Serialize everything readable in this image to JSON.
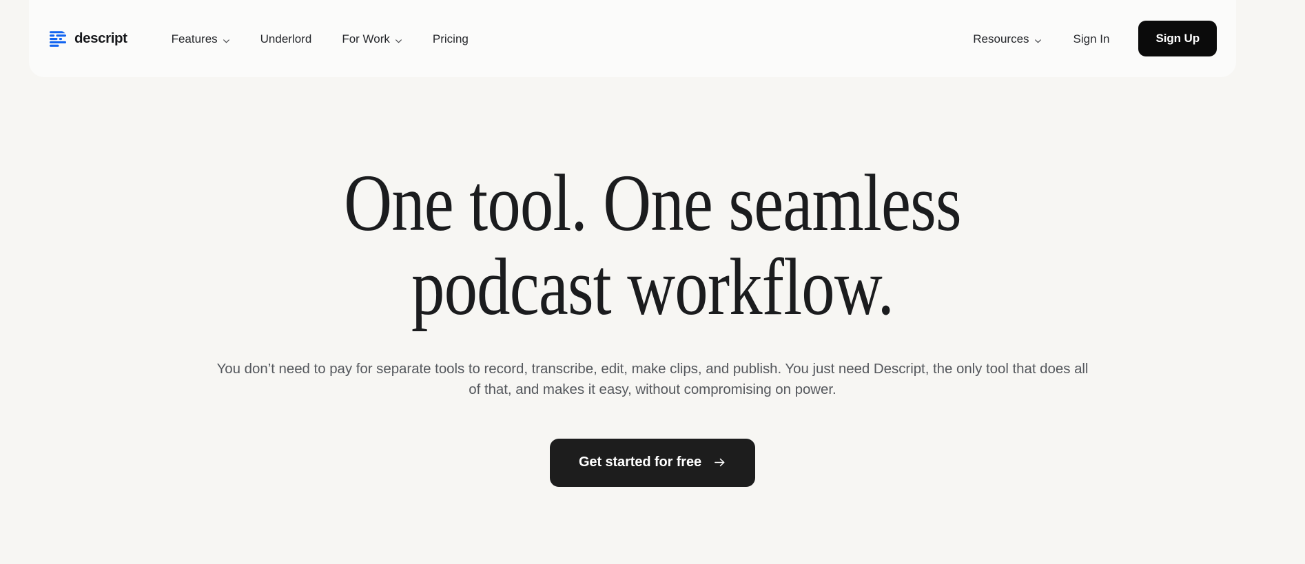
{
  "theme": {
    "page_background": "#f7f6f3",
    "header_background": "#fbfbfa",
    "brand_blue": "#1264f0",
    "text_dark": "#1b1c1e",
    "text_muted": "#55585d",
    "button_dark": "#0b0b0b",
    "cta_dark": "#1d1d1d"
  },
  "header": {
    "brand": {
      "name": "descript",
      "logo_icon": "descript-waveform-logo-icon"
    },
    "nav_primary": [
      {
        "label": "Features",
        "has_dropdown": true,
        "icon": "chevron-down-icon"
      },
      {
        "label": "Underlord",
        "has_dropdown": false,
        "icon": ""
      },
      {
        "label": "For Work",
        "has_dropdown": true,
        "icon": "chevron-down-icon"
      },
      {
        "label": "Pricing",
        "has_dropdown": false,
        "icon": ""
      }
    ],
    "nav_right": [
      {
        "label": "Resources",
        "has_dropdown": true,
        "icon": "chevron-down-icon"
      }
    ],
    "sign_in_label": "Sign In",
    "sign_up_label": "Sign Up"
  },
  "hero": {
    "headline_line_1": "One tool. One seamless",
    "headline_line_2": "podcast workflow.",
    "subheadline": "You don’t need to pay for separate tools to record, transcribe, edit, make clips, and publish. You just need Descript, the only tool that does all of that, and makes it easy, without compromising on power.",
    "cta": {
      "label": "Get started for free",
      "icon": "arrow-right-icon"
    }
  }
}
